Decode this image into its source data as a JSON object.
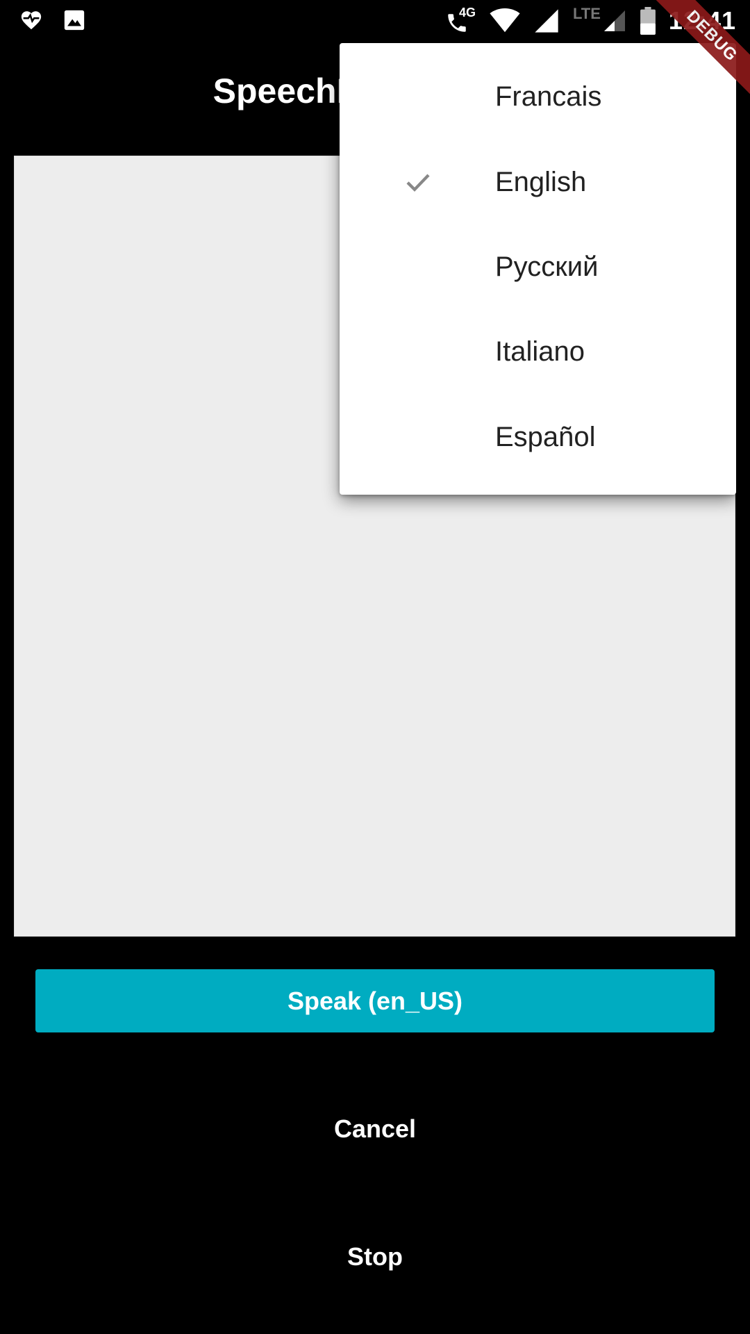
{
  "statusbar": {
    "time": "12:41",
    "network_label": "4G",
    "lte_label": "LTE",
    "icons": [
      "heart-pulse-icon",
      "image-icon",
      "call-icon",
      "wifi-icon",
      "signal-icon",
      "signal-weak-icon",
      "battery-icon"
    ]
  },
  "app": {
    "title": "SpeechRecognition"
  },
  "menu": {
    "items": [
      {
        "label": "Francais",
        "checked": false
      },
      {
        "label": "English",
        "checked": true
      },
      {
        "label": "Русский",
        "checked": false
      },
      {
        "label": "Italiano",
        "checked": false
      },
      {
        "label": "Español",
        "checked": false
      }
    ]
  },
  "buttons": {
    "speak": "Speak (en_US)",
    "cancel": "Cancel",
    "stop": "Stop"
  },
  "debug_banner": "DEBUG",
  "colors": {
    "accent": "#00acc1",
    "background": "#000000",
    "result_area": "#ededed",
    "debug": "#8b1a1a"
  }
}
